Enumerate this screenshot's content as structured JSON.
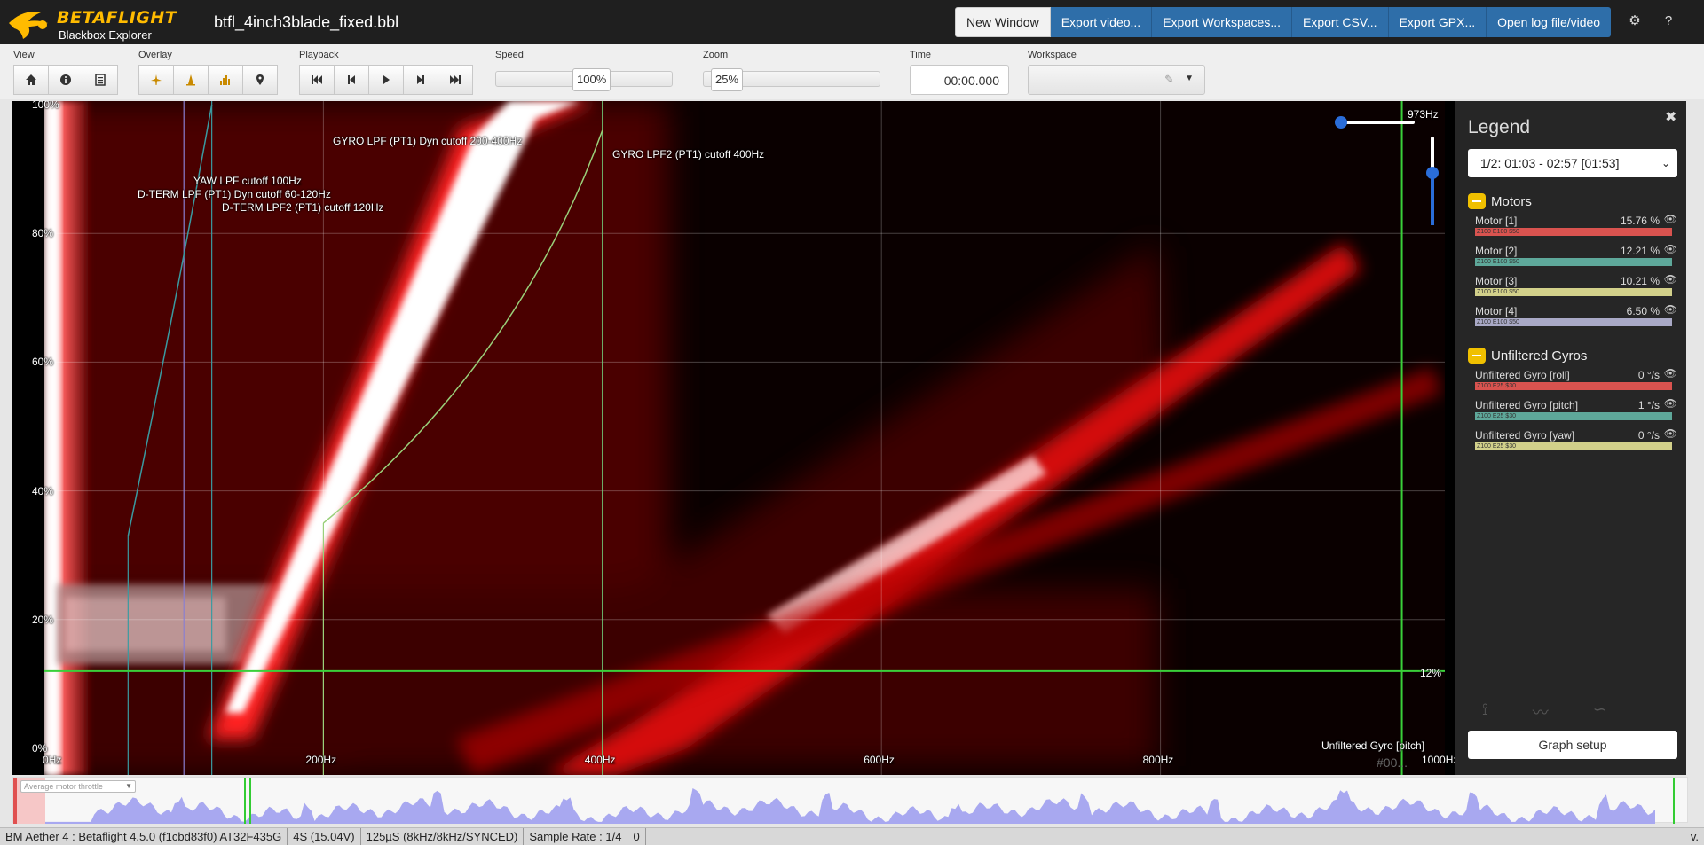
{
  "navbar": {
    "brand": "BETAFLIGHT",
    "subtitle": "Blackbox Explorer",
    "file_title": "btfl_4inch3blade_fixed.bbl",
    "buttons": [
      "New Window",
      "Export video...",
      "Export Workspaces...",
      "Export CSV...",
      "Export GPX...",
      "Open log file/video"
    ],
    "icons": [
      "gear-icon",
      "help-icon"
    ]
  },
  "toolbar": {
    "view_label": "View",
    "overlay_label": "Overlay",
    "playback_label": "Playback",
    "speed_label": "Speed",
    "speed_value": "100%",
    "speed_fraction": 0.5,
    "zoom_label": "Zoom",
    "zoom_value": "25%",
    "zoom_fraction": 0.04,
    "time_label": "Time",
    "time_value": "00:00.000",
    "workspace_label": "Workspace",
    "view_icons": [
      "home-icon",
      "info-icon",
      "log-list-icon"
    ],
    "overlay_icons": [
      "craft-icon",
      "sticks-icon",
      "analyser-icon",
      "map-pin-icon"
    ],
    "playback_icons": [
      "skip-start-icon",
      "step-back-icon",
      "play-icon",
      "step-forward-icon",
      "skip-end-icon"
    ]
  },
  "spectrum": {
    "y_ticks": [
      "100%",
      "80%",
      "60%",
      "40%",
      "20%",
      "0%"
    ],
    "x_ticks": [
      "0Hz",
      "200Hz",
      "400Hz",
      "600Hz",
      "800Hz",
      "1000Hz"
    ],
    "max_freq_label": "973Hz",
    "throttle_marker": "12%",
    "field_name": "Unfiltered Gyro [pitch]",
    "color_code": "#00...",
    "filter_labels": {
      "gyro_lpf_dyn": "GYRO LPF (PT1) Dyn cutoff 200-400Hz",
      "gyro_lpf2": "GYRO LPF2 (PT1) cutoff 400Hz",
      "yaw_lpf": "YAW LPF cutoff 100Hz",
      "dterm_lpf_dyn": "D-TERM LPF (PT1) Dyn cutoff 60-120Hz",
      "dterm_lpf2": "D-TERM LPF2 (PT1) cutoff 120Hz"
    }
  },
  "legend": {
    "title": "Legend",
    "selected_log": "1/2: 01:03 - 02:57 [01:53]",
    "groups": [
      {
        "name": "Motors",
        "fields": [
          {
            "name": "Motor [1]",
            "value": "15.76 %",
            "bar_text": "Z100 E100 $50",
            "color": "#d9534f"
          },
          {
            "name": "Motor [2]",
            "value": "12.21 %",
            "bar_text": "Z100 E100 $50",
            "color": "#5ea89a"
          },
          {
            "name": "Motor [3]",
            "value": "10.21 %",
            "bar_text": "Z100 E100 $50",
            "color": "#d2d08a"
          },
          {
            "name": "Motor [4]",
            "value": "6.50 %",
            "bar_text": "Z100 E100 $50",
            "color": "#a9a9c6"
          }
        ]
      },
      {
        "name": "Unfiltered Gyros",
        "fields": [
          {
            "name": "Unfiltered Gyro [roll]",
            "value": "0 °/s",
            "bar_text": "Z100 E25 $30",
            "color": "#d9534f"
          },
          {
            "name": "Unfiltered Gyro [pitch]",
            "value": "1 °/s",
            "bar_text": "Z100 E25 $30",
            "color": "#5ea89a"
          },
          {
            "name": "Unfiltered Gyro [yaw]",
            "value": "0 °/s",
            "bar_text": "Z100 E25 $30",
            "color": "#d2d08a"
          }
        ]
      }
    ],
    "graph_setup": "Graph setup"
  },
  "seekbar": {
    "select_value": "Average motor throttle"
  },
  "status": {
    "items": [
      "BM Aether 4 : Betaflight 4.5.0 (f1cbd83f0) AT32F435G",
      "4S (15.04V)",
      "125µS (8kHz/8kHz/SYNCED)",
      "Sample Rate : 1/4",
      "0"
    ],
    "version": "v."
  }
}
